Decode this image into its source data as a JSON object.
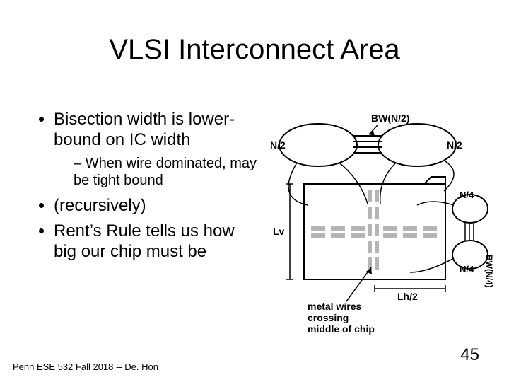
{
  "title": "VLSI Interconnect Area",
  "bullets": {
    "b1": "Bisection width is lower-bound on IC width",
    "b1_sub": "When wire dominated, may be tight bound",
    "b2": "(recursively)",
    "b3": "Rent’s Rule tells us how big our chip must be"
  },
  "diagram": {
    "bw_full": "BW(N/2)",
    "n2_left": "N/2",
    "n2_right": "N/2",
    "n4_top": "N/4",
    "n4_bot": "N/4",
    "bw_quarter": "BW(N/4)",
    "lv": "Lv",
    "lh2": "Lh/2",
    "caption_l1": "metal wires",
    "caption_l2": "crossing",
    "caption_l3": "middle of chip"
  },
  "footer": "Penn ESE 532 Fall 2018 -- De. Hon",
  "page": "45"
}
